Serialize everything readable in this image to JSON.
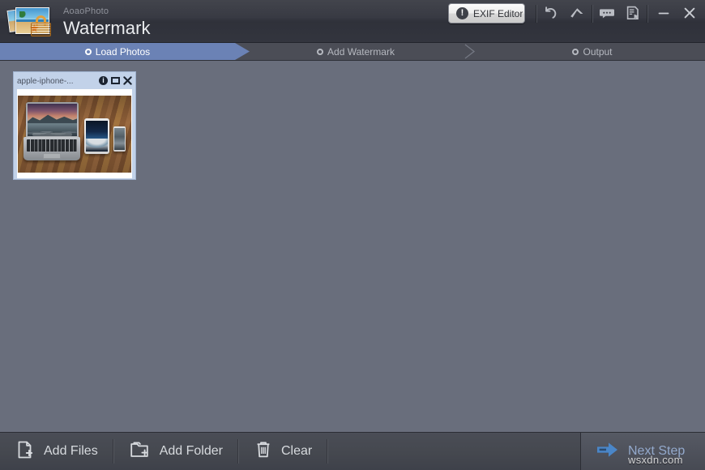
{
  "window": {
    "brand_sub": "AoaoPhoto",
    "brand_main": "Watermark",
    "logo_icon": "photos-with-padlock-icon"
  },
  "titlebar": {
    "exif_button": {
      "label": "EXIF Editor",
      "icon": "exclamation-circle-icon",
      "icon_glyph": "!"
    },
    "tools": [
      {
        "name": "undo-icon",
        "title": "Undo"
      },
      {
        "name": "upgrade-arrow-icon",
        "title": "Upgrade"
      },
      {
        "name": "feedback-bubble-icon",
        "title": "Feedback"
      },
      {
        "name": "register-document-icon",
        "title": "Register"
      }
    ],
    "controls": [
      {
        "name": "minimize-icon",
        "title": "Minimize"
      },
      {
        "name": "close-icon",
        "title": "Close"
      }
    ]
  },
  "steps": [
    {
      "label": "Load Photos",
      "active": true
    },
    {
      "label": "Add Watermark",
      "active": false
    },
    {
      "label": "Output",
      "active": false
    }
  ],
  "canvas": {
    "thumbnails": [
      {
        "filename": "apple-iphone-...",
        "selected": true,
        "actions": [
          {
            "name": "info-icon",
            "glyph": "i"
          },
          {
            "name": "preview-icon",
            "glyph": ""
          },
          {
            "name": "remove-icon",
            "glyph": "✕"
          }
        ],
        "image_description": "MacBook, iPad and iPhone on a wooden desk"
      }
    ]
  },
  "bottombar": {
    "actions": [
      {
        "label": "Add Files",
        "icon": "file-plus-icon"
      },
      {
        "label": "Add Folder",
        "icon": "folder-plus-icon"
      },
      {
        "label": "Clear",
        "icon": "trash-icon"
      }
    ],
    "next": {
      "label": "Next Step",
      "icon": "arrow-right-icon"
    }
  },
  "overlay": {
    "watermark_text": "wsxdn.com"
  },
  "colors": {
    "titlebar": "#373942",
    "canvas": "#696e7c",
    "step_active": "#6b82b5",
    "step_inactive": "#4b4d56",
    "bottombar": "#45484f",
    "card": "#c2d2e9",
    "next_step_text": "#93a9cc",
    "lock_accent": "#e3a03c"
  }
}
